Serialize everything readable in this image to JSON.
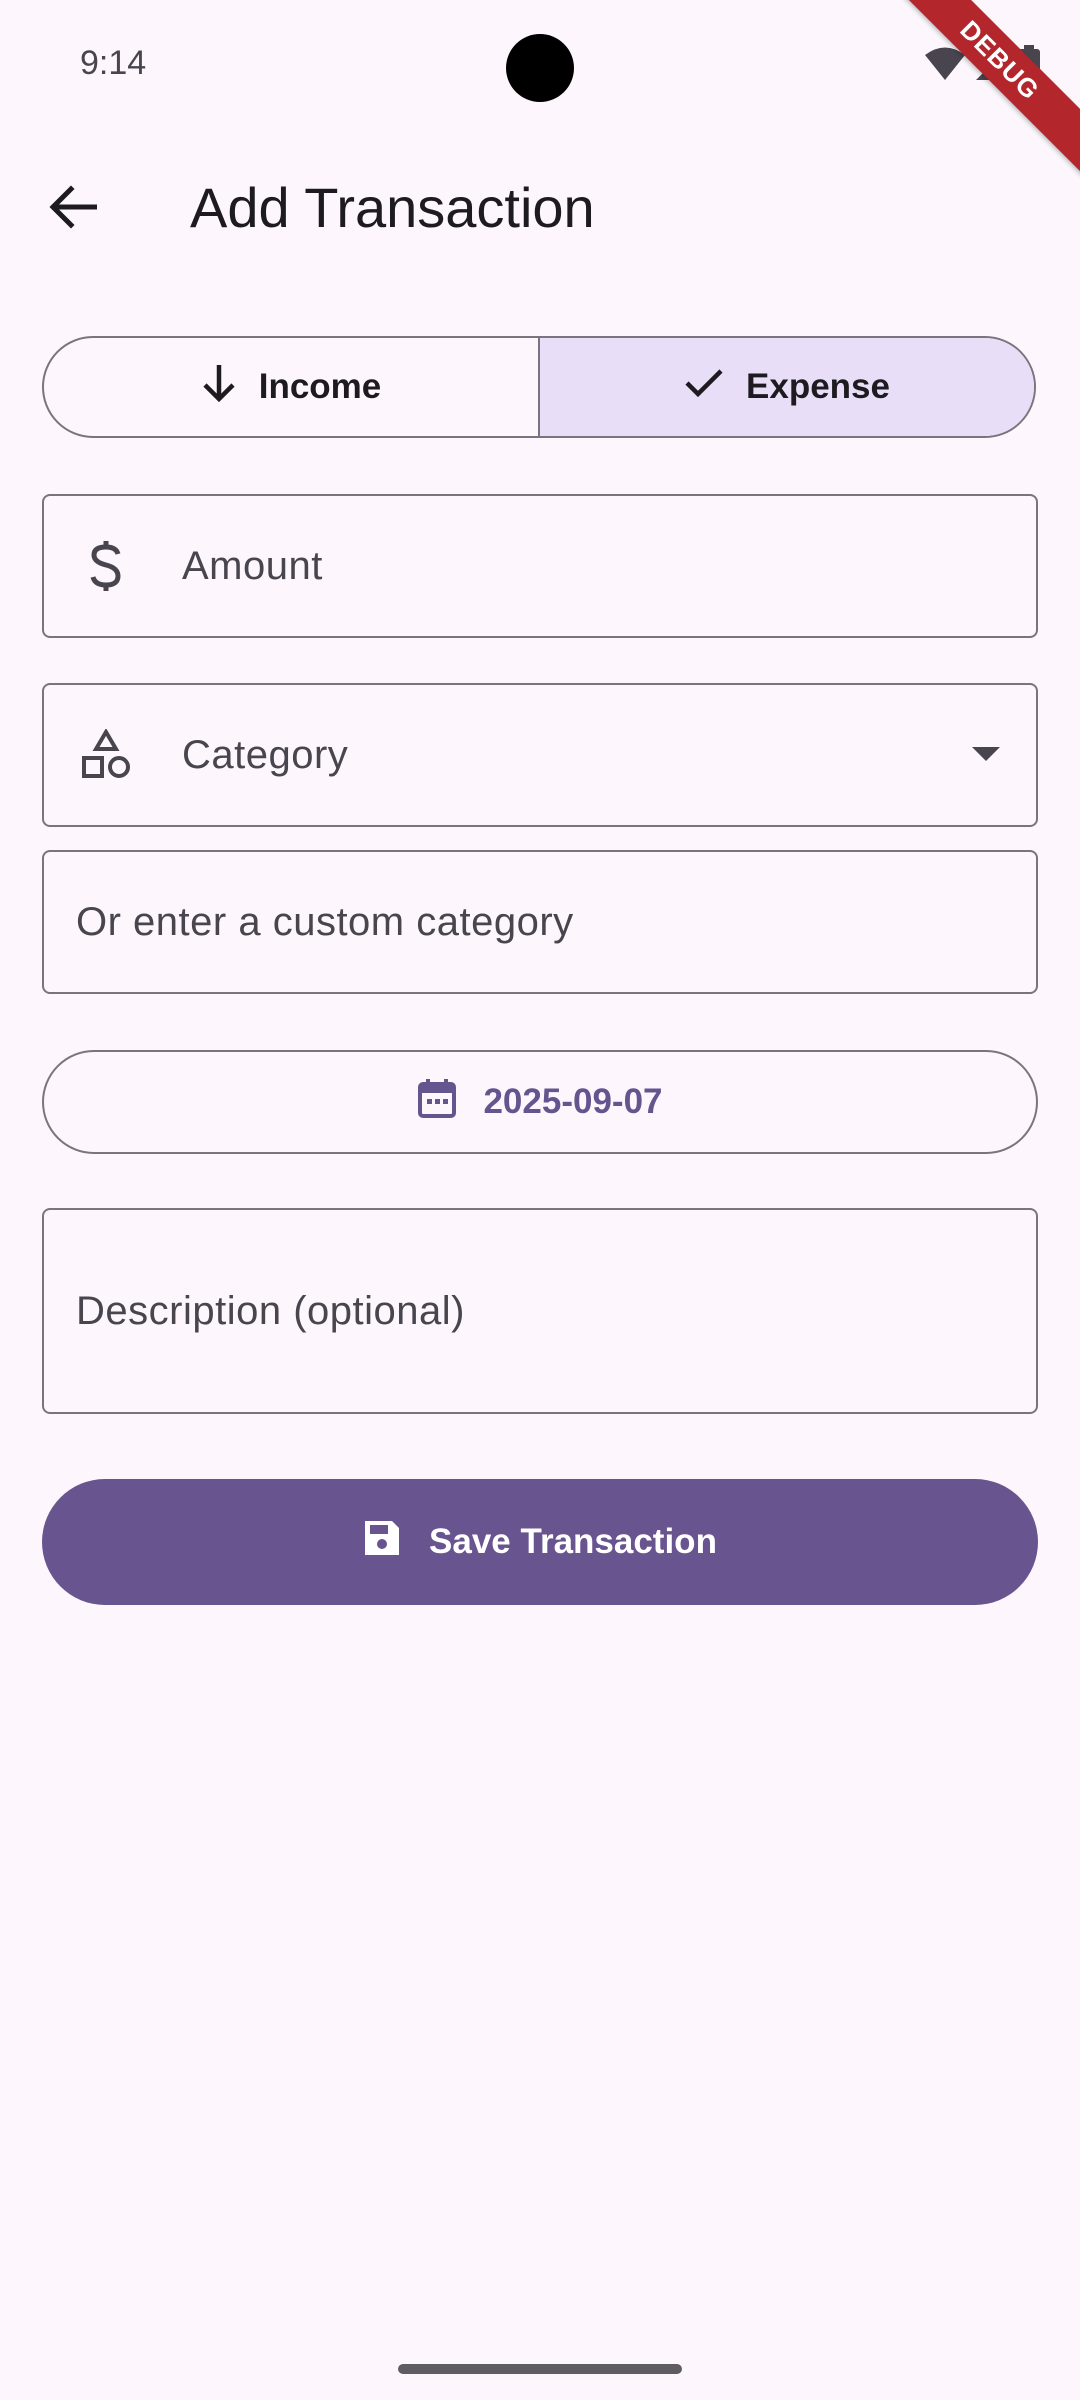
{
  "status_bar": {
    "time": "9:14",
    "icons": [
      "wifi-icon",
      "signal-icon",
      "battery-icon"
    ],
    "debug_label": "DEBUG"
  },
  "app_bar": {
    "back_icon": "arrow-back-icon",
    "title": "Add Transaction"
  },
  "type_toggle": {
    "options": [
      {
        "label": "Income",
        "icon": "arrow-down-icon",
        "selected": false
      },
      {
        "label": "Expense",
        "icon": "check-icon",
        "selected": true
      }
    ]
  },
  "form": {
    "amount": {
      "placeholder": "Amount",
      "value": "",
      "icon": "dollar-icon"
    },
    "category": {
      "placeholder": "Category",
      "value": "",
      "icon": "category-shapes-icon",
      "trailing_icon": "dropdown-arrow-icon"
    },
    "custom_category": {
      "placeholder": "Or enter a custom category",
      "value": ""
    },
    "date": {
      "value": "2025-09-07",
      "icon": "calendar-icon"
    },
    "description": {
      "placeholder": "Description (optional)",
      "value": ""
    }
  },
  "actions": {
    "save_label": "Save Transaction",
    "save_icon": "save-icon"
  },
  "colors": {
    "background": "#fdf7fd",
    "primary": "#68548e",
    "selected_segment": "#e8def8",
    "outline": "#79747e",
    "debug_banner": "#b3262c"
  }
}
